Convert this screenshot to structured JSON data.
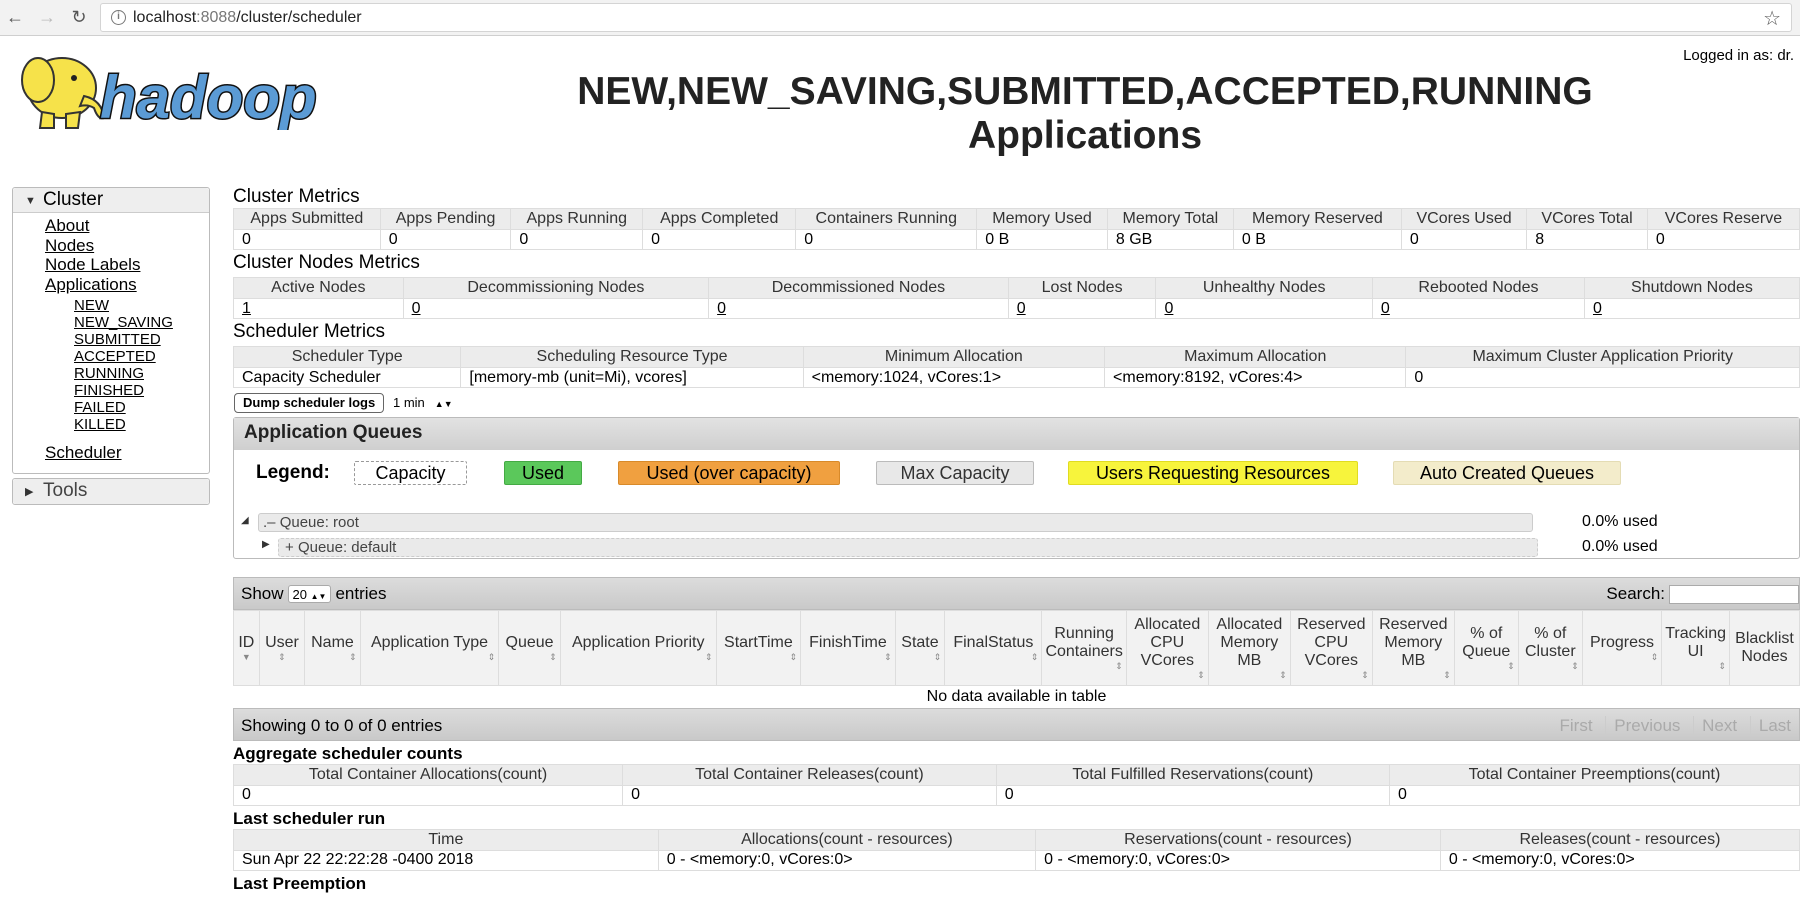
{
  "browser": {
    "url_host": "localhost",
    "url_port": ":8088",
    "url_path": "/cluster/scheduler"
  },
  "header": {
    "logo_text": "hadoop",
    "title_line1": "NEW,NEW_SAVING,SUBMITTED,ACCEPTED,RUNNING",
    "title_line2": "Applications",
    "logged_in": "Logged in as: dr."
  },
  "sidebar": {
    "cluster_label": "Cluster",
    "items": [
      "About",
      "Nodes",
      "Node Labels",
      "Applications"
    ],
    "app_states": [
      "NEW",
      "NEW_SAVING",
      "SUBMITTED",
      "ACCEPTED",
      "RUNNING",
      "FINISHED",
      "FAILED",
      "KILLED"
    ],
    "scheduler": "Scheduler",
    "tools_label": "Tools"
  },
  "cluster_metrics": {
    "title": "Cluster Metrics",
    "headers": [
      "Apps Submitted",
      "Apps Pending",
      "Apps Running",
      "Apps Completed",
      "Containers Running",
      "Memory Used",
      "Memory Total",
      "Memory Reserved",
      "VCores Used",
      "VCores Total",
      "VCores Reserve"
    ],
    "values": [
      "0",
      "0",
      "0",
      "0",
      "0",
      "0 B",
      "8 GB",
      "0 B",
      "0",
      "8",
      "0"
    ]
  },
  "node_metrics": {
    "title": "Cluster Nodes Metrics",
    "headers": [
      "Active Nodes",
      "Decommissioning Nodes",
      "Decommissioned Nodes",
      "Lost Nodes",
      "Unhealthy Nodes",
      "Rebooted Nodes",
      "Shutdown Nodes"
    ],
    "values": [
      "1",
      "0",
      "0",
      "0",
      "0",
      "0",
      "0"
    ]
  },
  "scheduler_metrics": {
    "title": "Scheduler Metrics",
    "headers": [
      "Scheduler Type",
      "Scheduling Resource Type",
      "Minimum Allocation",
      "Maximum Allocation",
      "Maximum Cluster Application Priority"
    ],
    "values": [
      "Capacity Scheduler",
      "[memory-mb (unit=Mi), vcores]",
      "<memory:1024, vCores:1>",
      "<memory:8192, vCores:4>",
      "0"
    ]
  },
  "dump": {
    "button": "Dump scheduler logs",
    "interval": "1 min"
  },
  "queues": {
    "title": "Application Queues",
    "legend_label": "Legend:",
    "legend": {
      "capacity": "Capacity",
      "used": "Used",
      "over": "Used (over capacity)",
      "max": "Max Capacity",
      "users": "Users Requesting Resources",
      "auto": "Auto Created Queues"
    },
    "root_label": "Queue: root",
    "root_used": "0.0% used",
    "default_label": "Queue: default",
    "default_used": "0.0% used"
  },
  "apps_table": {
    "show": "Show",
    "entries_count": "20",
    "entries": "entries",
    "search": "Search:",
    "headers": [
      "ID",
      "User",
      "Name",
      "Application Type",
      "Queue",
      "Application Priority",
      "StartTime",
      "FinishTime",
      "State",
      "FinalStatus",
      "Running Containers",
      "Allocated CPU VCores",
      "Allocated Memory MB",
      "Reserved CPU VCores",
      "Reserved Memory MB",
      "% of Queue",
      "% of Cluster",
      "Progress",
      "Tracking UI",
      "Blacklist Nodes"
    ],
    "empty": "No data available in table",
    "showing": "Showing 0 to 0 of 0 entries",
    "pager": [
      "First",
      "Previous",
      "Next",
      "Last"
    ]
  },
  "aggregate": {
    "title": "Aggregate scheduler counts",
    "headers": [
      "Total Container Allocations(count)",
      "Total Container Releases(count)",
      "Total Fulfilled Reservations(count)",
      "Total Container Preemptions(count)"
    ],
    "values": [
      "0",
      "0",
      "0",
      "0"
    ]
  },
  "last_run": {
    "title": "Last scheduler run",
    "headers": [
      "Time",
      "Allocations(count - resources)",
      "Reservations(count - resources)",
      "Releases(count - resources)"
    ],
    "values": [
      "Sun Apr 22 22:22:28 -0400 2018",
      "0 - <memory:0, vCores:0>",
      "0 - <memory:0, vCores:0>",
      "0 - <memory:0, vCores:0>"
    ]
  },
  "last_preemption": {
    "title": "Last Preemption"
  }
}
